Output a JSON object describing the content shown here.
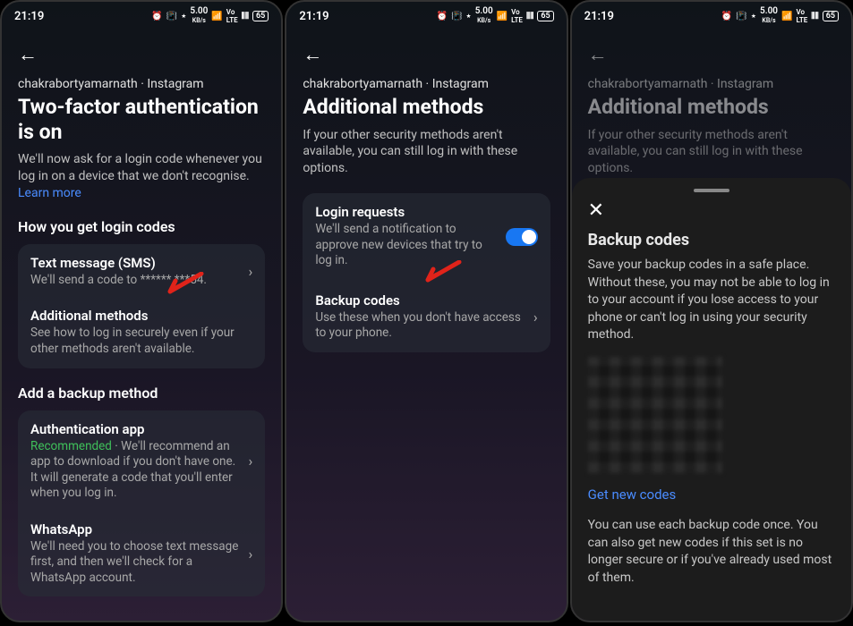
{
  "status": {
    "time": "21:19",
    "icons": "⏰ 📳 ⋆ 5.00 KB/s 📶 ᴴᴰ ⫴ 📶 ⫴ 65",
    "alarm": "⏰",
    "vibrate": "📳",
    "bt": "⋆",
    "speed": "5.00",
    "speed_unit": "KB/s",
    "battery": "65"
  },
  "screen1": {
    "breadcrumb": "chakrabortyamarnath · Instagram",
    "title": "Two-factor authentication is on",
    "subtitle": "We'll now ask for a login code whenever you log in on a device that we don't recognise.",
    "learn_more": "Learn more",
    "section_codes": "How you get login codes",
    "sms_title": "Text message (SMS)",
    "sms_sub": "We'll send a code to ****** ***54.",
    "addl_title": "Additional methods",
    "addl_sub": "See how to log in securely even if your other methods aren't available.",
    "section_backup": "Add a backup method",
    "authapp_title": "Authentication app",
    "recommended": "Recommended",
    "authapp_sub": " · We'll recommend an app to download if you don't have one. It will generate a code that you'll enter when you log in.",
    "whatsapp_title": "WhatsApp",
    "whatsapp_sub": "We'll need you to choose text message first, and then we'll check for a WhatsApp account."
  },
  "screen2": {
    "breadcrumb": "chakrabortyamarnath · Instagram",
    "title": "Additional methods",
    "subtitle": "If your other security methods aren't available, you can still log in with these options.",
    "login_title": "Login requests",
    "login_sub": "We'll send a notification to approve new devices that try to log in.",
    "backup_title": "Backup codes",
    "backup_sub": "Use these when you don't have access to your phone."
  },
  "screen3": {
    "breadcrumb": "chakrabortyamarnath · Instagram",
    "title": "Additional methods",
    "subtitle": "If your other security methods aren't available, you can still log in with these options.",
    "sheet_title": "Backup codes",
    "sheet_text": "Save your backup codes in a safe place. Without these, you may not be able to log in to your account if you lose access to your phone or can't log in using your security method.",
    "get_new": "Get new codes",
    "footer": "You can use each backup code once. You can also get new codes if this set is no longer secure or if you've already used most of them."
  }
}
